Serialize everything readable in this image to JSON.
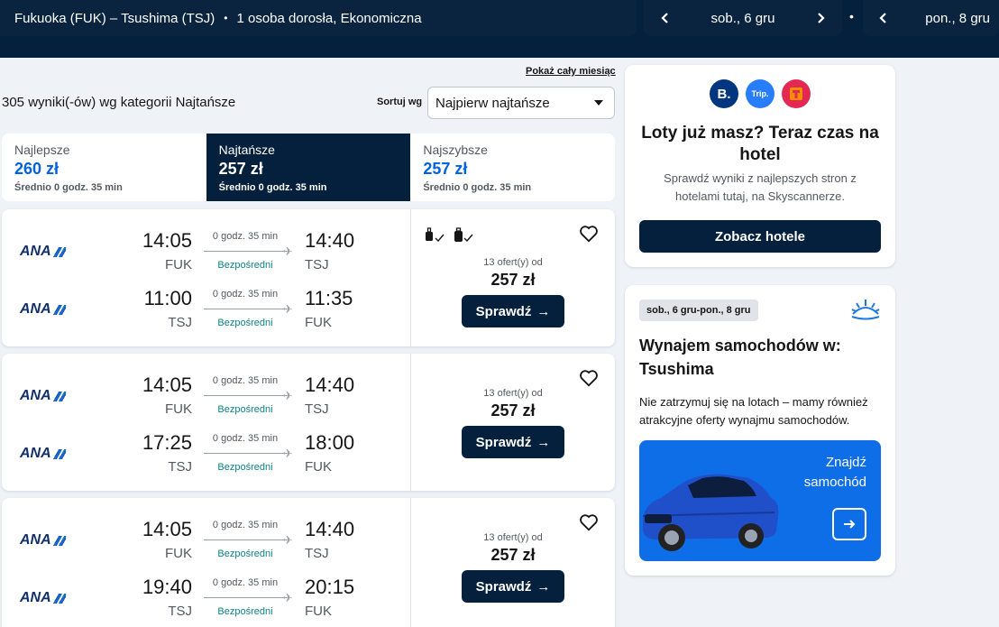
{
  "header": {
    "route": "Fukuoka (FUK) – Tsushima (TSJ)",
    "passengers": "1 osoba dorosła, Ekonomiczna",
    "depart_date": "sob., 6 gru",
    "return_date": "pon., 8 gru"
  },
  "results": {
    "show_month": "Pokaż cały miesiąc",
    "count_text": "305 wyniki(-ów) wg kategorii Najtańsze",
    "sort_label": "Sortuj wg",
    "sort_value": "Najpierw najtańsze"
  },
  "tabs": [
    {
      "label": "Najlepsze",
      "price": "260 zł",
      "sub": "Średnio 0 godz. 35 min"
    },
    {
      "label": "Najtańsze",
      "price": "257 zł",
      "sub": "Średnio 0 godz. 35 min"
    },
    {
      "label": "Najszybsze",
      "price": "257 zł",
      "sub": "Średnio 0 godz. 35 min"
    }
  ],
  "flights": [
    {
      "airline": "ANA",
      "legs": [
        {
          "dep_time": "14:05",
          "dep_code": "FUK",
          "duration": "0 godz. 35 min",
          "stops": "Bezpośredni",
          "arr_time": "14:40",
          "arr_code": "TSJ"
        },
        {
          "dep_time": "11:00",
          "dep_code": "TSJ",
          "duration": "0 godz. 35 min",
          "stops": "Bezpośredni",
          "arr_time": "11:35",
          "arr_code": "FUK"
        }
      ],
      "offers": "13 ofert(y) od",
      "price": "257 zł",
      "button": "Sprawdź"
    },
    {
      "airline": "ANA",
      "legs": [
        {
          "dep_time": "14:05",
          "dep_code": "FUK",
          "duration": "0 godz. 35 min",
          "stops": "Bezpośredni",
          "arr_time": "14:40",
          "arr_code": "TSJ"
        },
        {
          "dep_time": "17:25",
          "dep_code": "TSJ",
          "duration": "0 godz. 35 min",
          "stops": "Bezpośredni",
          "arr_time": "18:00",
          "arr_code": "FUK"
        }
      ],
      "offers": "13 ofert(y) od",
      "price": "257 zł",
      "button": "Sprawdź"
    },
    {
      "airline": "ANA",
      "legs": [
        {
          "dep_time": "14:05",
          "dep_code": "FUK",
          "duration": "0 godz. 35 min",
          "stops": "Bezpośredni",
          "arr_time": "14:40",
          "arr_code": "TSJ"
        },
        {
          "dep_time": "19:40",
          "dep_code": "TSJ",
          "duration": "0 godz. 35 min",
          "stops": "Bezpośredni",
          "arr_time": "20:15",
          "arr_code": "FUK"
        }
      ],
      "offers": "13 ofert(y) od",
      "price": "257 zł",
      "button": "Sprawdź"
    }
  ],
  "hotel": {
    "logos": [
      "B.",
      "Trip.",
      "trivago"
    ],
    "title": "Loty już masz? Teraz czas na hotel",
    "subtitle": "Sprawdź wyniki z najlepszych stron z hotelami tutaj, na Skyscannerze.",
    "button": "Zobacz hotele"
  },
  "car": {
    "dates": "sob., 6 gru-pon., 8 gru",
    "title": "Wynajem samochodów w: Tsushima",
    "subtitle": "Nie zatrzymuj się na lotach – mamy również atrakcyjne oferty wynajmu samochodów.",
    "promo": "Znajdź samochód"
  },
  "colors": {
    "navy": "#05203c",
    "accent_blue": "#0062e3",
    "direct_teal": "#0c838a",
    "promo_blue": "#0e6ee8"
  }
}
